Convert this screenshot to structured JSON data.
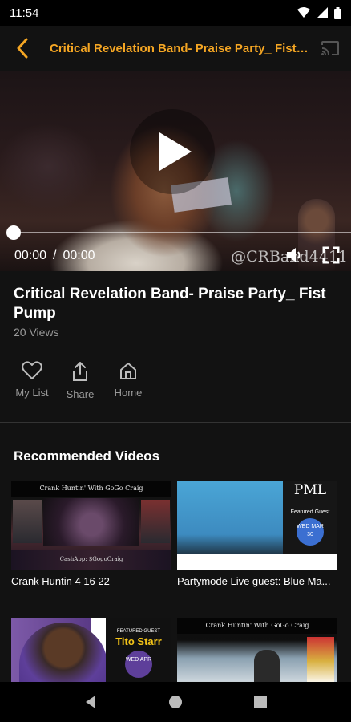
{
  "status_bar": {
    "time": "11:54",
    "icons": [
      "wifi-icon",
      "signal-icon",
      "battery-icon"
    ]
  },
  "app_bar": {
    "title": "Critical Revelation Band- Praise Party_ Fist Pump",
    "back_icon": "chevron-left-icon",
    "cast_icon": "cast-icon",
    "accent_color": "#f5a623"
  },
  "player": {
    "current_time": "00:00",
    "separator": "/",
    "duration": "00:00",
    "watermark": "@CRBand4411",
    "progress": 0,
    "icons": [
      "play-icon",
      "volume-icon",
      "fullscreen-icon"
    ]
  },
  "video": {
    "title": "Critical Revelation Band- Praise Party_ Fist Pump",
    "views": "20 Views"
  },
  "actions": [
    {
      "label": "My List",
      "icon": "heart-icon"
    },
    {
      "label": "Share",
      "icon": "share-icon"
    },
    {
      "label": "Home",
      "icon": "home-icon"
    }
  ],
  "recommended": {
    "heading": "Recommended Videos",
    "items": [
      {
        "title": "Crank Huntin 4 16 22",
        "thumb_header": "Crank Huntin' With GoGo Craig",
        "thumb_footer": "CashApp: $GogoCraig"
      },
      {
        "title": "Partymode Live guest: Blue Ma...",
        "thumb_logo": "PML",
        "thumb_guest": "Featured Guest",
        "thumb_date": "WED MAR 30"
      },
      {
        "title": "",
        "thumb_guest": "FEATURED GUEST",
        "thumb_name": "Tito Starr",
        "thumb_date": "WED APR"
      },
      {
        "title": "",
        "thumb_header": "Crank Huntin' With GoGo Craig"
      }
    ]
  }
}
